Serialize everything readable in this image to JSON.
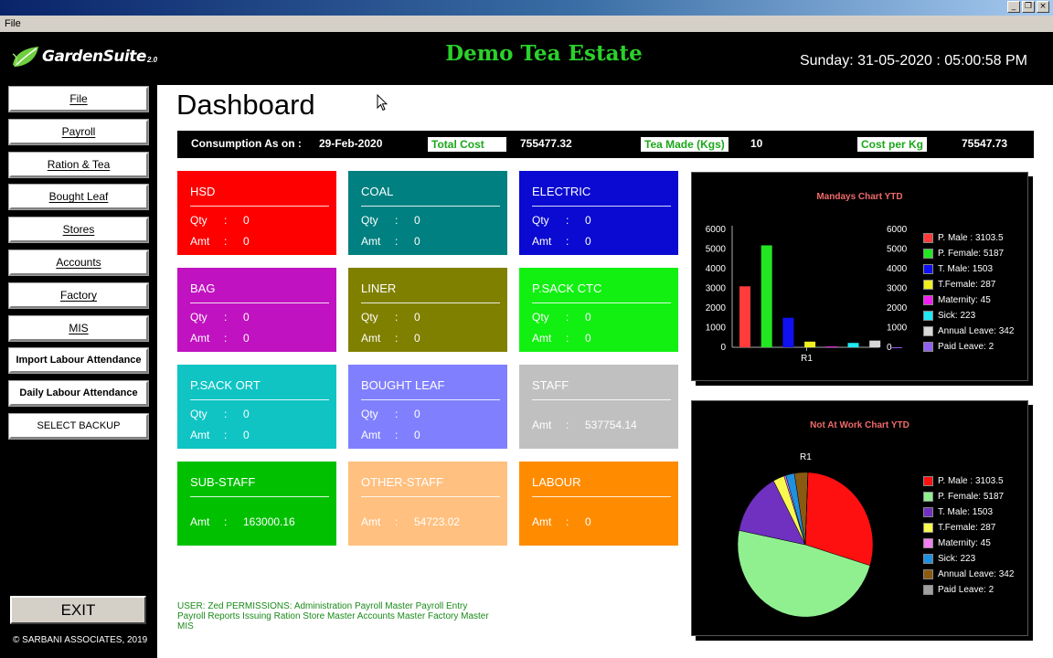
{
  "window": {
    "min": "_",
    "restore": "❐",
    "close": "×"
  },
  "menu": {
    "file": "File"
  },
  "header": {
    "logo_text": "GardenSuite",
    "logo_version": "2.0",
    "estate_name": "Demo Tea Estate",
    "datetime": "Sunday: 31-05-2020 : 05:00:58 PM"
  },
  "sidebar": {
    "items": [
      {
        "label": "File"
      },
      {
        "label": "Payroll"
      },
      {
        "label": "Ration & Tea"
      },
      {
        "label": "Bought Leaf"
      },
      {
        "label": "Stores"
      },
      {
        "label": "Accounts"
      },
      {
        "label": "Factory"
      },
      {
        "label": "MIS"
      },
      {
        "label": "Import Labour Attendance"
      },
      {
        "label": "Daily Labour Attendance"
      },
      {
        "label": "SELECT BACKUP LOCATION"
      }
    ],
    "exit_label": "EXIT",
    "copyright": "© SARBANI ASSOCIATES, 2019"
  },
  "main": {
    "title": "Dashboard",
    "consumption": {
      "label": "Consumption As on :",
      "date": "29-Feb-2020",
      "total_cost_label": "Total Cost",
      "total_cost_value": "755477.32",
      "tea_made_label": "Tea Made (Kgs)",
      "tea_made_value": "10",
      "cost_per_kg_label": "Cost per Kg",
      "cost_per_kg_value": "75547.73"
    },
    "qty_label": "Qty",
    "amt_label": "Amt",
    "sep": ":",
    "cards": [
      {
        "title": "HSD",
        "qty": "0",
        "amt": "0",
        "color": "#ff0000"
      },
      {
        "title": "COAL",
        "qty": "0",
        "amt": "0",
        "color": "#008080"
      },
      {
        "title": "ELECTRIC",
        "qty": "0",
        "amt": "0",
        "color": "#0a0ad2"
      },
      {
        "title": "BAG",
        "qty": "0",
        "amt": "0",
        "color": "#c012c0"
      },
      {
        "title": "LINER",
        "qty": "0",
        "amt": "0",
        "color": "#808000"
      },
      {
        "title": "P.SACK CTC",
        "qty": "0",
        "amt": "0",
        "color": "#12f012"
      },
      {
        "title": "P.SACK ORT",
        "qty": "0",
        "amt": "0",
        "color": "#10c4c4"
      },
      {
        "title": "BOUGHT LEAF",
        "qty": "0",
        "amt": "0",
        "color": "#8080ff"
      },
      {
        "title": "STAFF",
        "amt": "537754.14",
        "color": "#c0c0c0"
      },
      {
        "title": "SUB-STAFF",
        "amt": "163000.16",
        "color": "#00c000"
      },
      {
        "title": "OTHER-STAFF",
        "amt": "54723.02",
        "color": "#ffc080"
      },
      {
        "title": "LABOUR",
        "amt": "0",
        "color": "#ff8c00"
      }
    ],
    "permissions": "USER: Zed PERMISSIONS:   Administration Payroll Master Payroll Entry Payroll Reports Issuing Ration Store Master Accounts Master Factory Master MIS"
  },
  "chart_data": [
    {
      "type": "bar",
      "title": "Mandays Chart YTD",
      "categories": [
        "R1"
      ],
      "ylim": [
        0,
        6000
      ],
      "yticks": [
        "6000",
        "5000",
        "4000",
        "3000",
        "2000",
        "1000",
        "0"
      ],
      "series": [
        {
          "name": "P. Male : 3103.5",
          "values": [
            3103.5
          ],
          "color": "#ff3b3b"
        },
        {
          "name": "P. Female: 5187",
          "values": [
            5187
          ],
          "color": "#22e622"
        },
        {
          "name": "T. Male: 1503",
          "values": [
            1503
          ],
          "color": "#1010f0"
        },
        {
          "name": "T.Female: 287",
          "values": [
            287
          ],
          "color": "#f0f020"
        },
        {
          "name": "Maternity: 45",
          "values": [
            45
          ],
          "color": "#f020f0"
        },
        {
          "name": "Sick: 223",
          "values": [
            223
          ],
          "color": "#20e8f0"
        },
        {
          "name": "Annual Leave: 342",
          "values": [
            342
          ],
          "color": "#d8d8d8"
        },
        {
          "name": "Paid Leave: 2",
          "values": [
            2
          ],
          "color": "#9060f0"
        }
      ],
      "legend": "right"
    },
    {
      "type": "pie",
      "title": "Not At Work Chart YTD",
      "categories": [
        "R1"
      ],
      "series": [
        {
          "name": "P. Male : 3103.5",
          "values": [
            3103.5
          ],
          "color": "#ff1010"
        },
        {
          "name": "P. Female: 5187",
          "values": [
            5187
          ],
          "color": "#90f090"
        },
        {
          "name": "T. Male: 1503",
          "values": [
            1503
          ],
          "color": "#7030c0"
        },
        {
          "name": "T.Female: 287",
          "values": [
            287
          ],
          "color": "#f8f850"
        },
        {
          "name": "Maternity: 45",
          "values": [
            45
          ],
          "color": "#f080f0"
        },
        {
          "name": "Sick: 223",
          "values": [
            223
          ],
          "color": "#2090e0"
        },
        {
          "name": "Annual Leave: 342",
          "values": [
            342
          ],
          "color": "#8a5a10"
        },
        {
          "name": "Paid Leave: 2",
          "values": [
            2
          ],
          "color": "#a0a0a0"
        }
      ],
      "legend": "right"
    }
  ]
}
